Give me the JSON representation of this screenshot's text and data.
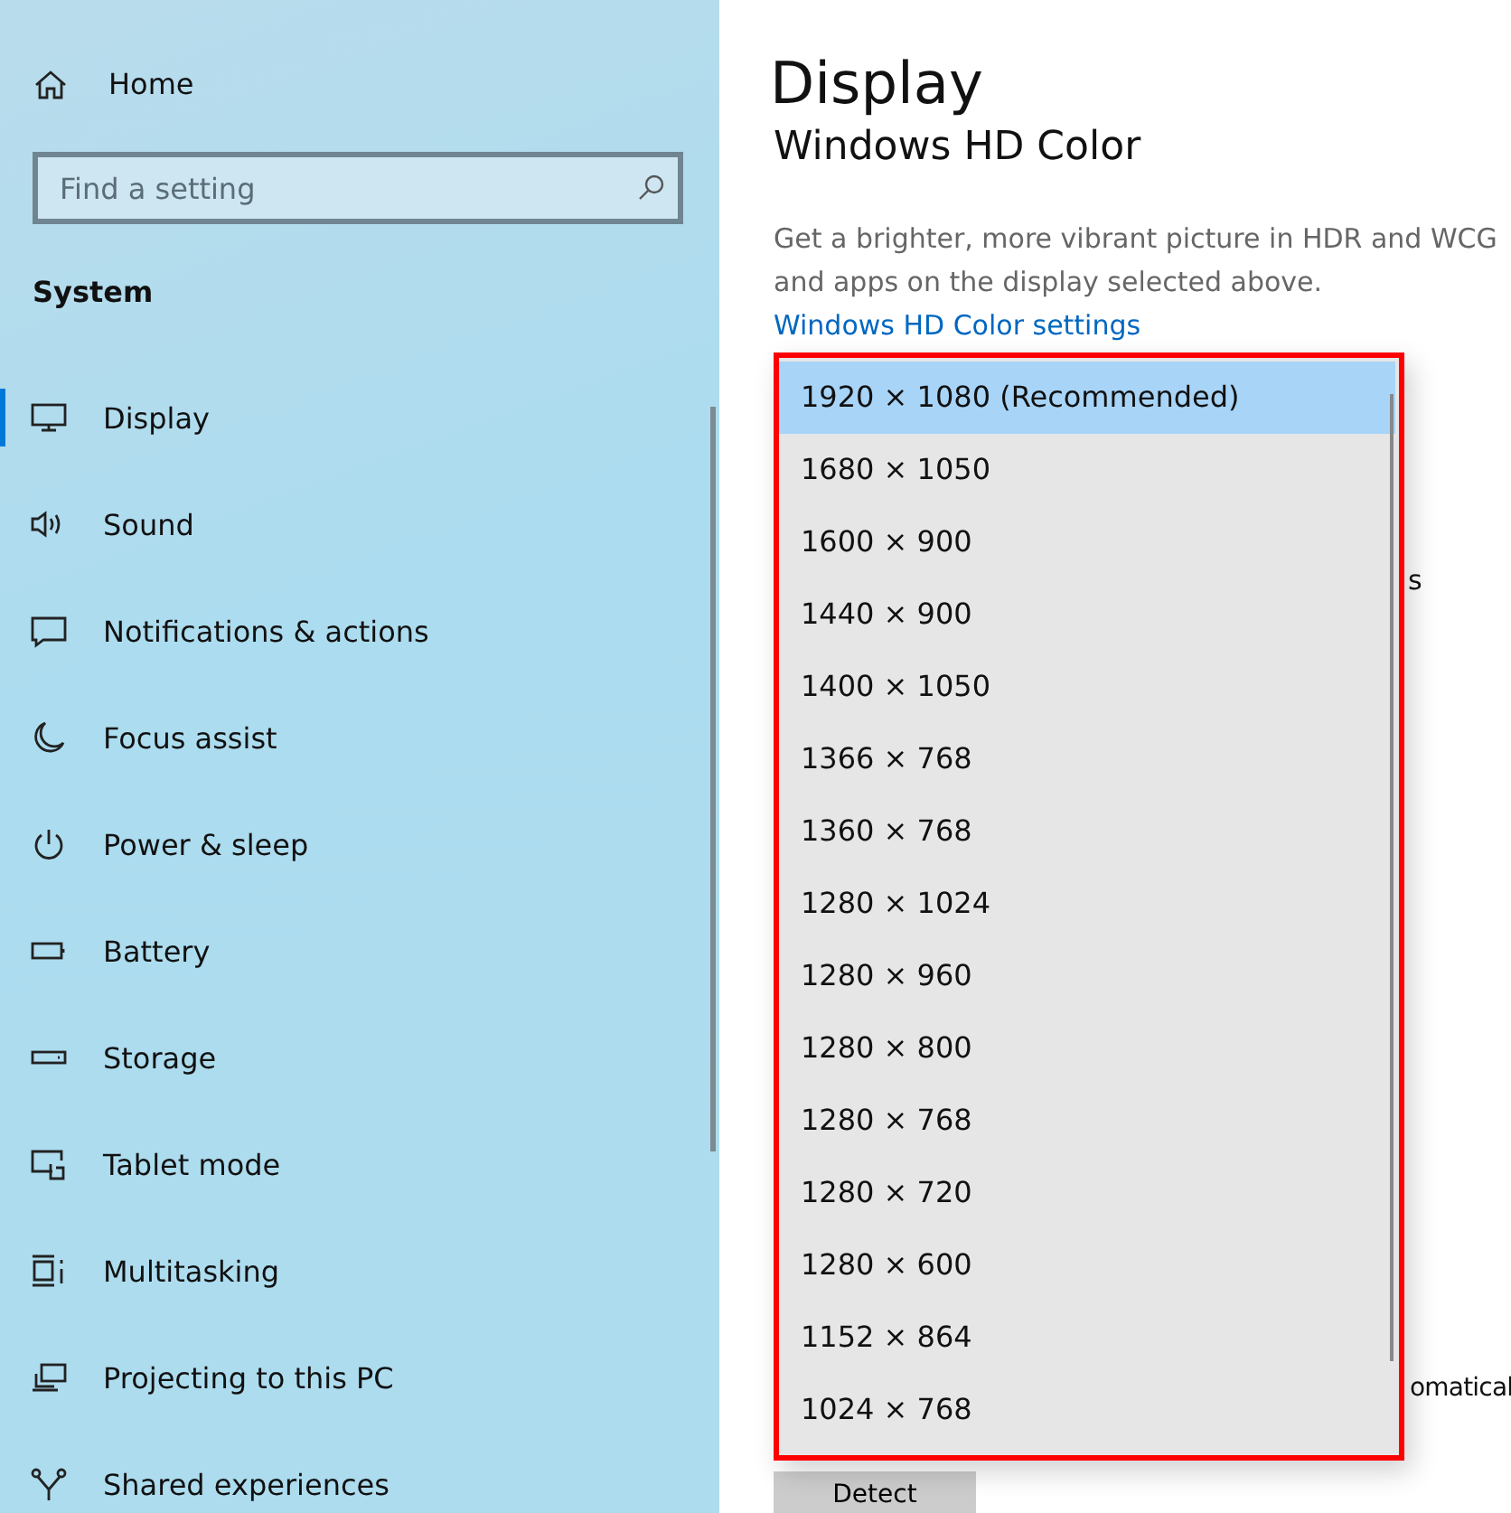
{
  "sidebar": {
    "home": "Home",
    "search": {
      "placeholder": "Find a setting"
    },
    "section": "System",
    "items": [
      {
        "label": "Display",
        "selected": true
      },
      {
        "label": "Sound",
        "selected": false
      },
      {
        "label": "Notifications & actions",
        "selected": false
      },
      {
        "label": "Focus assist",
        "selected": false
      },
      {
        "label": "Power & sleep",
        "selected": false
      },
      {
        "label": "Battery",
        "selected": false
      },
      {
        "label": "Storage",
        "selected": false
      },
      {
        "label": "Tablet mode",
        "selected": false
      },
      {
        "label": "Multitasking",
        "selected": false
      },
      {
        "label": "Projecting to this PC",
        "selected": false
      },
      {
        "label": "Shared experiences",
        "selected": false
      }
    ]
  },
  "main": {
    "title": "Display",
    "heading": "Windows HD Color",
    "description": "Get a brighter, more vibrant picture in HDR and WCG\nand apps on the display selected above.",
    "link": "Windows HD Color settings",
    "fragment_1": "s",
    "fragment_2": "omatical",
    "button": "Detect"
  },
  "resolution_dropdown": {
    "options": [
      {
        "label": "1920 × 1080 (Recommended)",
        "selected": true
      },
      {
        "label": "1680 × 1050",
        "selected": false
      },
      {
        "label": "1600 × 900",
        "selected": false
      },
      {
        "label": "1440 × 900",
        "selected": false
      },
      {
        "label": "1400 × 1050",
        "selected": false
      },
      {
        "label": "1366 × 768",
        "selected": false
      },
      {
        "label": "1360 × 768",
        "selected": false
      },
      {
        "label": "1280 × 1024",
        "selected": false
      },
      {
        "label": "1280 × 960",
        "selected": false
      },
      {
        "label": "1280 × 800",
        "selected": false
      },
      {
        "label": "1280 × 768",
        "selected": false
      },
      {
        "label": "1280 × 720",
        "selected": false
      },
      {
        "label": "1280 × 600",
        "selected": false
      },
      {
        "label": "1152 × 864",
        "selected": false
      },
      {
        "label": "1024 × 768",
        "selected": false
      }
    ]
  }
}
